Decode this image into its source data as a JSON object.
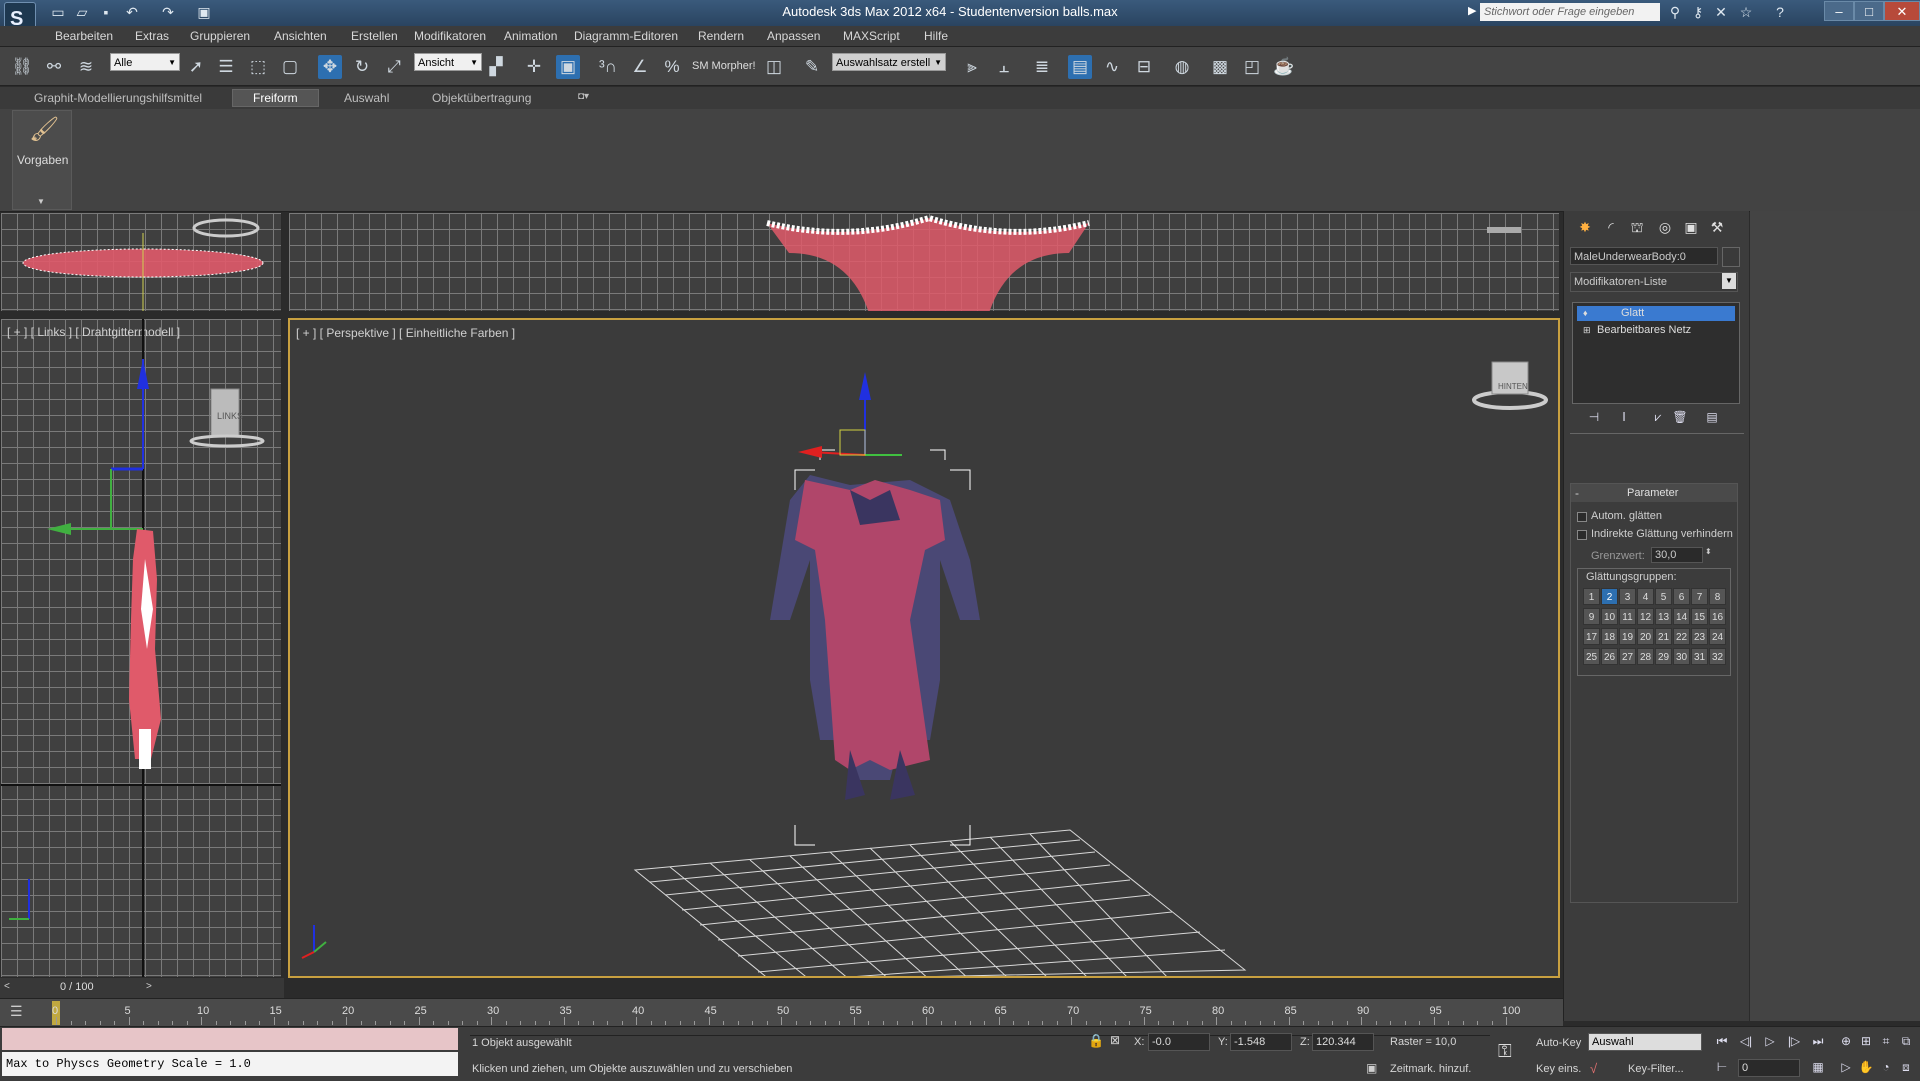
{
  "window": {
    "title": "Autodesk 3ds Max  2012 x64  - Studentenversion   balls.max",
    "search_placeholder": "Stichwort oder Frage eingeben",
    "logo_icon": "3ds-max-logo-icon"
  },
  "menu": [
    "Bearbeiten",
    "Extras",
    "Gruppieren",
    "Ansichten",
    "Erstellen",
    "Modifikatoren",
    "Animation",
    "Diagramm-Editoren",
    "Rendern",
    "Anpassen",
    "MAXScript",
    "Hilfe"
  ],
  "toolbar": {
    "filter_select": "Alle",
    "coord_select": "Ansicht",
    "sm_morpher": "SM Morpher!",
    "selection_set": "Auswahlsatz erstell",
    "accent": "#2d6fb0"
  },
  "ribbon": {
    "tabs": [
      "Graphit-Modellierungshilfsmittel",
      "Freiform",
      "Auswahl",
      "Objektübertragung"
    ],
    "active_tab": "Freiform",
    "panel_label": "Vorgaben"
  },
  "viewports": {
    "left_label": "[ + ] [ Links ] [ Drahtgittermodell ]",
    "persp_label": "[ + ] [ Perspektive ] [ Einheitliche Farben ]",
    "viewcube_left_text": "LINKS",
    "viewcube_persp_text": "HINTEN"
  },
  "command_panel": {
    "object_name": "MaleUnderwearBody:0",
    "modifier_list": "Modifikatoren-Liste",
    "stack": [
      {
        "label": "Glatt",
        "selected": true
      },
      {
        "label": "Bearbeitbares Netz",
        "selected": false
      }
    ],
    "rollout_title": "Parameter",
    "auto_smooth": "Autom. glätten",
    "prevent_indirect": "Indirekte Glättung verhindern",
    "threshold_label": "Grenzwert:",
    "threshold_value": "30,0",
    "smoothing_groups_label": "Glättungsgruppen:",
    "smoothing_groups": [
      "1",
      "2",
      "3",
      "4",
      "5",
      "6",
      "7",
      "8",
      "9",
      "10",
      "11",
      "12",
      "13",
      "14",
      "15",
      "16",
      "17",
      "18",
      "19",
      "20",
      "21",
      "22",
      "23",
      "24",
      "25",
      "26",
      "27",
      "28",
      "29",
      "30",
      "31",
      "32"
    ],
    "active_group": "2"
  },
  "timeline": {
    "frame_display": "0 / 100",
    "ticks": [
      "0",
      "5",
      "10",
      "15",
      "20",
      "25",
      "30",
      "35",
      "40",
      "45",
      "50",
      "55",
      "60",
      "65",
      "70",
      "75",
      "80",
      "85",
      "90",
      "95",
      "100"
    ]
  },
  "status": {
    "maxscript_output": "Max to Physcs Geometry Scale = 1.0",
    "selection_info": "1 Objekt ausgewählt",
    "prompt": "Klicken und ziehen, um Objekte auszuwählen und zu verschieben",
    "x_label": "X:",
    "x_value": "-0.0",
    "y_label": "Y:",
    "y_value": "-1.548",
    "z_label": "Z:",
    "z_value": "120.344",
    "grid": "Raster = 10,0",
    "add_time_tag": "Zeitmark. hinzuf.",
    "auto_key": "Auto-Key",
    "set_key": "Key eins.",
    "selection_mode": "Auswahl",
    "key_filter": "Key-Filter...",
    "frame_value": "0"
  }
}
